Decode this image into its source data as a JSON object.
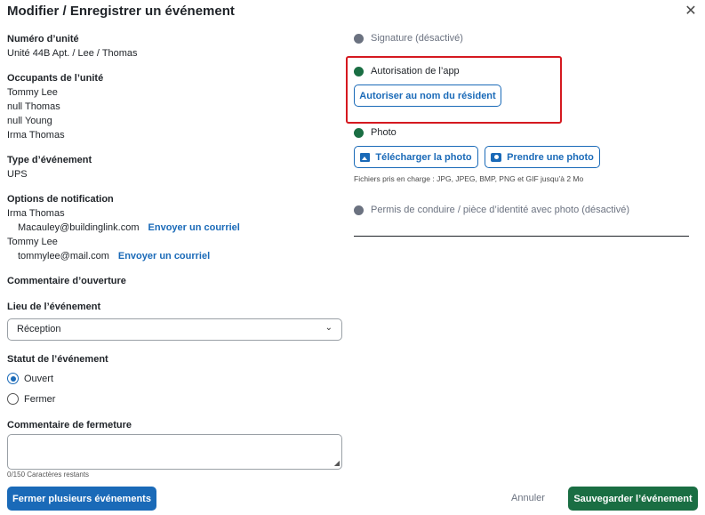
{
  "dialog": {
    "title": "Modifier / Enregistrer un événement",
    "close_icon": "close-icon"
  },
  "unit": {
    "label": "Numéro d’unité",
    "value": "Unité 44B Apt. / Lee / Thomas"
  },
  "occupants": {
    "label": "Occupants de l’unité",
    "list": [
      "Tommy Lee",
      "null Thomas",
      "null Young",
      "Irma Thomas"
    ]
  },
  "event_type": {
    "label": "Type d’événement",
    "value": "UPS"
  },
  "notifications": {
    "label": "Options de notification",
    "entries": [
      {
        "name": "Irma Thomas",
        "email": "Macauley@buildinglink.com",
        "action": "Envoyer un courriel"
      },
      {
        "name": "Tommy Lee",
        "email": "tommylee@mail.com",
        "action": "Envoyer un courriel"
      }
    ]
  },
  "opening_comment": {
    "label": "Commentaire d’ouverture"
  },
  "location": {
    "label": "Lieu de l’événement",
    "selected": "Réception"
  },
  "status": {
    "label": "Statut de l’événement",
    "options": [
      {
        "label": "Ouvert",
        "checked": true
      },
      {
        "label": "Fermer",
        "checked": false
      }
    ]
  },
  "closing_comment": {
    "label": "Commentaire de fermeture",
    "value": "",
    "char_count": "0/150 Caractères restants"
  },
  "right": {
    "signature": "Signature (désactivé)",
    "app_auth": "Autorisation de l’app",
    "authorize_button": "Autoriser au nom du résident",
    "photo": "Photo",
    "upload_button": "Télécharger la photo",
    "take_button": "Prendre une photo",
    "file_note": "Fichiers pris en charge : JPG, JPEG, BMP, PNG et GIF jusqu’à 2 Mo",
    "license": "Permis de conduire / pièce d’identité avec photo (désactivé)"
  },
  "footer": {
    "close_multiple": "Fermer plusieurs événements",
    "cancel": "Annuler",
    "save": "Sauvegarder l’événement"
  },
  "colors": {
    "primary": "#1a6ab8",
    "success": "#1a6e43",
    "highlight": "#d51920",
    "disabled_dot": "#6b7280"
  }
}
